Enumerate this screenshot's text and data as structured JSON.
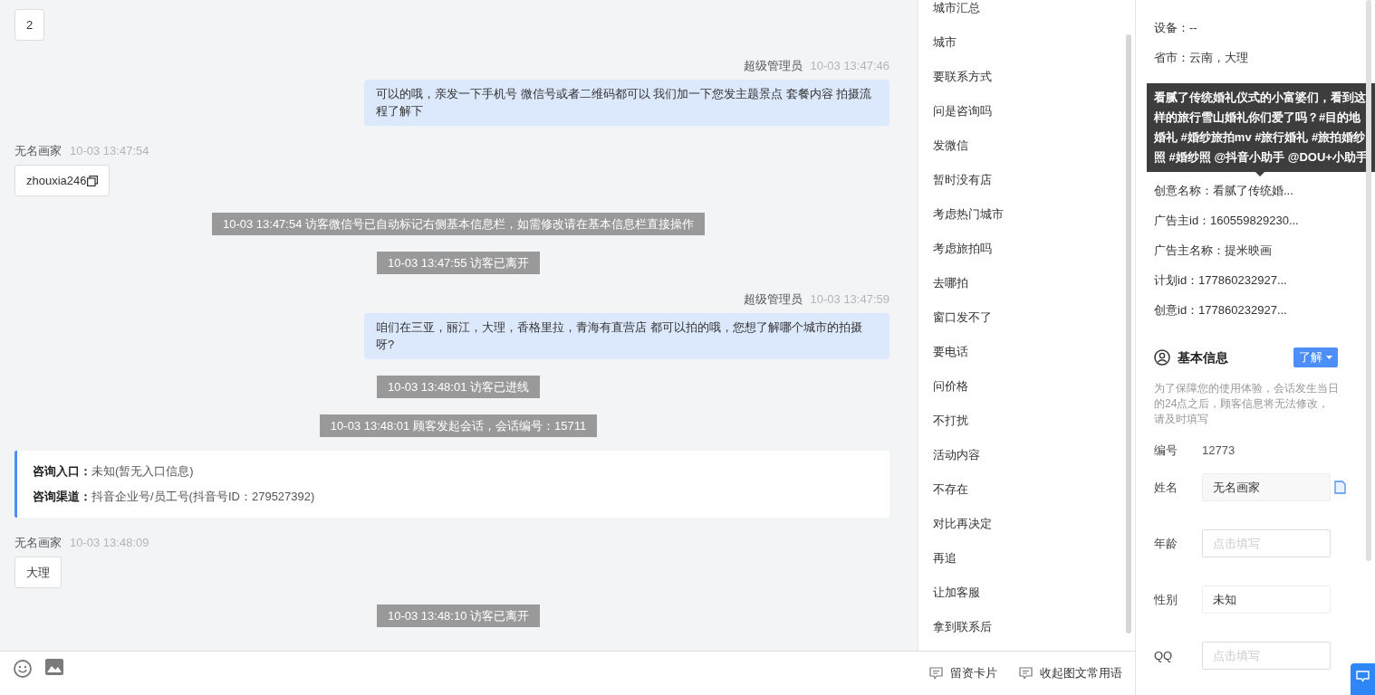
{
  "chat": {
    "messages": [
      {
        "kind": "visitor",
        "text": "2"
      },
      {
        "kind": "agent",
        "name": "超级管理员",
        "time": "10-03 13:47:46",
        "text": "可以的哦，亲发一下手机号 微信号或者二维码都可以 我们加一下您发主题景点 套餐内容 拍摄流程了解下"
      },
      {
        "kind": "visitor",
        "name": "无名画家",
        "time": "10-03 13:47:54",
        "text": "zhouxia246",
        "copyable": true
      },
      {
        "kind": "system",
        "text": "10-03 13:47:54 访客微信号已自动标记右侧基本信息栏，如需修改请在基本信息栏直接操作"
      },
      {
        "kind": "system",
        "text": "10-03 13:47:55 访客已离开"
      },
      {
        "kind": "agent",
        "name": "超级管理员",
        "time": "10-03 13:47:59",
        "text": "咱们在三亚，丽江，大理，香格里拉，青海有直营店 都可以拍的哦，您想了解哪个城市的拍摄呀?"
      },
      {
        "kind": "system",
        "text": "10-03 13:48:01 访客已进线"
      },
      {
        "kind": "system",
        "text": "10-03 13:48:01 顾客发起会话，会话编号：15711"
      },
      {
        "kind": "entry",
        "rows": [
          {
            "label": "咨询入口：",
            "value": "未知(暂无入口信息)"
          },
          {
            "label": "咨询渠道：",
            "value": "抖音企业号/员工号(抖音号ID：279527392)"
          }
        ]
      },
      {
        "kind": "visitor",
        "name": "无名画家",
        "time": "10-03 13:48:09",
        "text": "大理"
      },
      {
        "kind": "system",
        "text": "10-03 13:48:10 访客已离开"
      }
    ]
  },
  "phrases": {
    "items": [
      "城市汇总",
      "城市",
      "要联系方式",
      "问是咨询吗",
      "发微信",
      "暂时没有店",
      "考虑热门城市",
      "考虑旅拍吗",
      "去哪拍",
      "窗口发不了",
      "要电话",
      "问价格",
      "不打扰",
      "活动内容",
      "不存在",
      "对比再决定",
      "再追",
      "让加客服",
      "拿到联系后"
    ],
    "footer": [
      "留资卡片",
      "收起图文常用语"
    ]
  },
  "visitor_info": {
    "rows_before": [
      "设备：--",
      "省市：云南，大理"
    ],
    "tooltip": "看腻了传统婚礼仪式的小富婆们，看到这样的旅行雪山婚礼你们爱了吗？#目的地婚礼 #婚纱旅拍mv #旅行婚礼 #旅拍婚纱照 #婚纱照 @抖音小助手 @DOU+小助手",
    "rows_after": [
      "创意名称：看腻了传统婚...",
      "广告主id：160559829230...",
      "广告主名称：提米映画",
      "计划id：177860232927...",
      "创意id：177860232927..."
    ]
  },
  "basic_info": {
    "title": "基本信息",
    "tag": "了解",
    "note": "为了保障您的使用体验，会话发生当日的24点之后，顾客信息将无法修改，请及时填写",
    "fields": [
      {
        "kind": "text",
        "label": "编号",
        "value": "12773"
      },
      {
        "kind": "readonly",
        "label": "姓名",
        "value": "无名画家"
      },
      {
        "kind": "input",
        "label": "年龄",
        "placeholder": "点击填写"
      },
      {
        "kind": "select",
        "label": "性别",
        "value": "未知"
      },
      {
        "kind": "input",
        "label": "QQ",
        "placeholder": "点击填写"
      }
    ]
  }
}
